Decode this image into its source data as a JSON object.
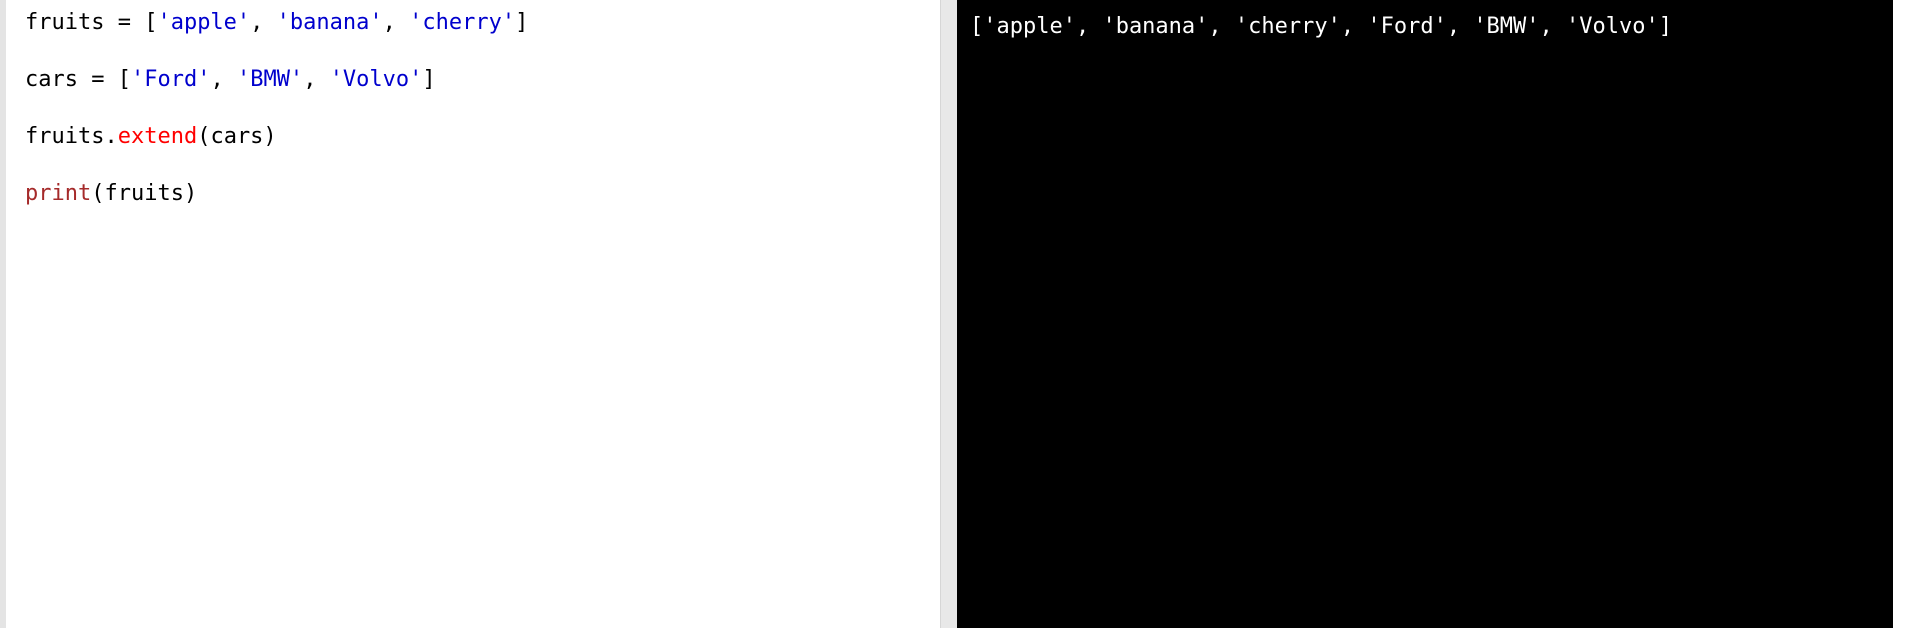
{
  "colors": {
    "text": "#000000",
    "string": "#0000cd",
    "method": "#ff0000",
    "builtin": "#a52a2a",
    "output_bg": "#000000",
    "output_text": "#ffffff"
  },
  "editor": {
    "lines": [
      {
        "tokens": [
          {
            "text": "fruits = [",
            "kind": "text"
          },
          {
            "text": "'apple'",
            "kind": "string"
          },
          {
            "text": ", ",
            "kind": "text"
          },
          {
            "text": "'banana'",
            "kind": "string"
          },
          {
            "text": ", ",
            "kind": "text"
          },
          {
            "text": "'cherry'",
            "kind": "string"
          },
          {
            "text": "]",
            "kind": "text"
          }
        ]
      },
      {
        "tokens": [
          {
            "text": "cars = [",
            "kind": "text"
          },
          {
            "text": "'Ford'",
            "kind": "string"
          },
          {
            "text": ", ",
            "kind": "text"
          },
          {
            "text": "'BMW'",
            "kind": "string"
          },
          {
            "text": ", ",
            "kind": "text"
          },
          {
            "text": "'Volvo'",
            "kind": "string"
          },
          {
            "text": "]",
            "kind": "text"
          }
        ]
      },
      {
        "tokens": [
          {
            "text": "fruits.",
            "kind": "text"
          },
          {
            "text": "extend",
            "kind": "method"
          },
          {
            "text": "(cars)",
            "kind": "text"
          }
        ]
      },
      {
        "tokens": [
          {
            "text": "print",
            "kind": "builtin"
          },
          {
            "text": "(fruits)",
            "kind": "text"
          }
        ]
      }
    ]
  },
  "output": {
    "text": "['apple', 'banana', 'cherry', 'Ford', 'BMW', 'Volvo']"
  }
}
